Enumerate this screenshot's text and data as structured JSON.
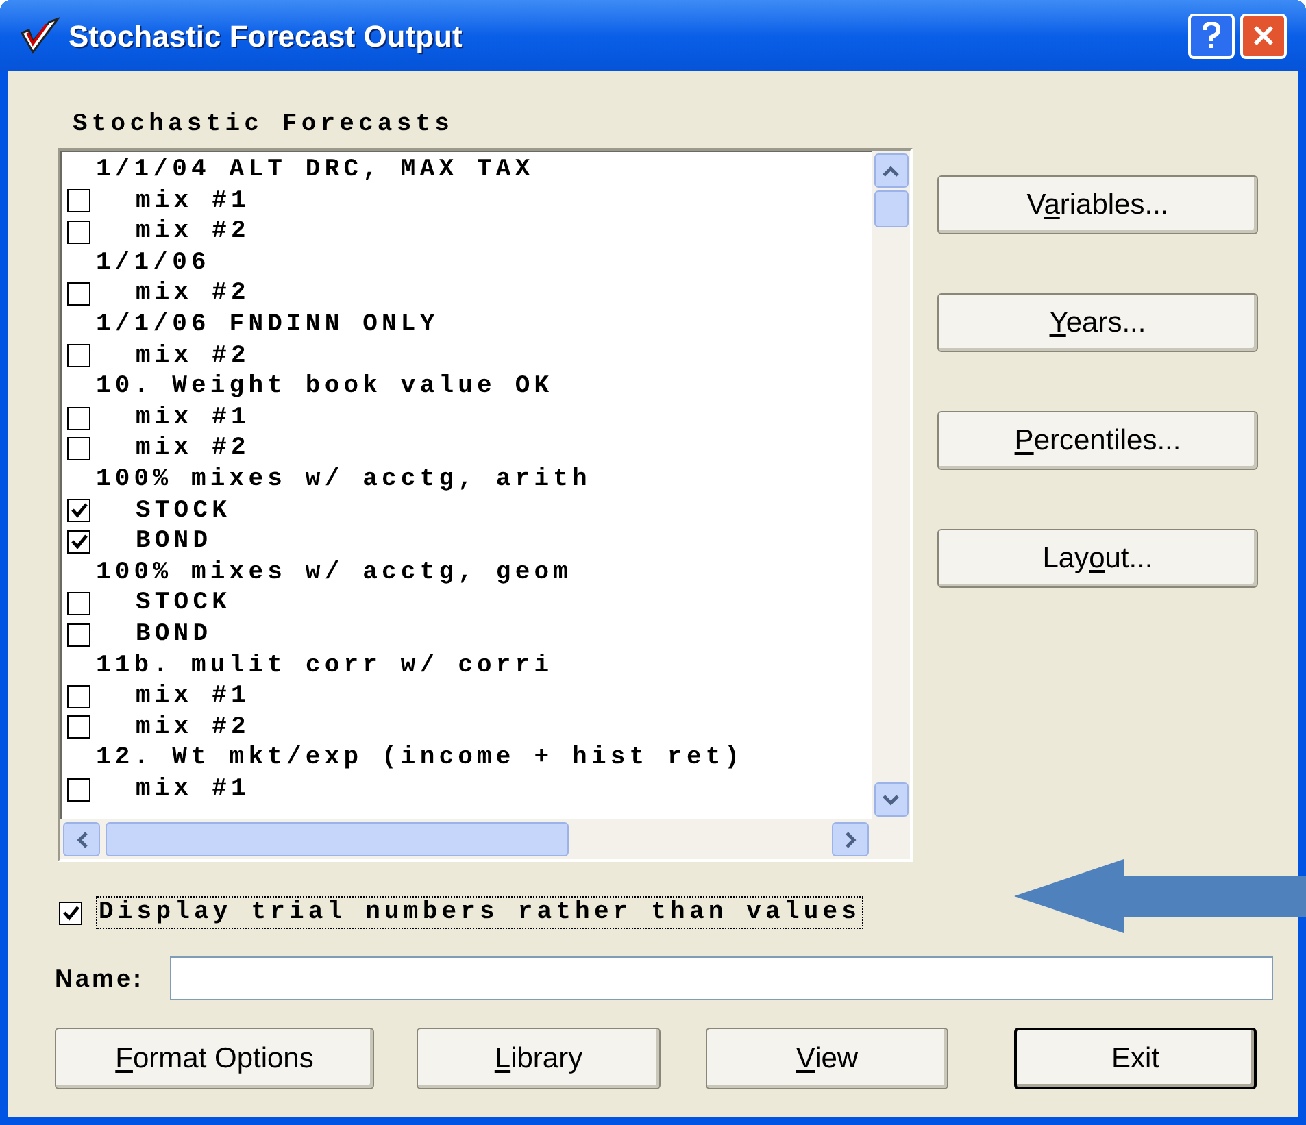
{
  "window": {
    "title": "Stochastic Forecast Output"
  },
  "list_title": "Stochastic Forecasts",
  "forecasts": [
    {
      "title": "1/1/04 ALT DRC, MAX TAX",
      "children": [
        {
          "label": "mix #1",
          "checked": false
        },
        {
          "label": "mix #2",
          "checked": false
        }
      ]
    },
    {
      "title": "1/1/06",
      "children": [
        {
          "label": "mix #2",
          "checked": false
        }
      ]
    },
    {
      "title": "1/1/06 FNDINN ONLY",
      "children": [
        {
          "label": "mix #2",
          "checked": false
        }
      ]
    },
    {
      "title": "10. Weight book value OK",
      "children": [
        {
          "label": "mix #1",
          "checked": false
        },
        {
          "label": "mix #2",
          "checked": false
        }
      ]
    },
    {
      "title": "100% mixes w/ acctg, arith",
      "children": [
        {
          "label": "STOCK",
          "checked": true
        },
        {
          "label": "BOND",
          "checked": true
        }
      ]
    },
    {
      "title": "100% mixes w/ acctg, geom",
      "children": [
        {
          "label": "STOCK",
          "checked": false
        },
        {
          "label": "BOND",
          "checked": false
        }
      ]
    },
    {
      "title": "11b. mulit corr w/ corri",
      "children": [
        {
          "label": "mix #1",
          "checked": false
        },
        {
          "label": "mix #2",
          "checked": false
        }
      ]
    },
    {
      "title": "12. Wt mkt/exp (income + hist ret)",
      "children": [
        {
          "label": "mix #1",
          "checked": false
        }
      ]
    }
  ],
  "side_buttons": [
    {
      "before": "V",
      "key": "a",
      "after": "riables...",
      "default": false
    },
    {
      "key": "Y",
      "after": "ears...",
      "default": false
    },
    {
      "key": "P",
      "after": "ercentiles...",
      "default": false
    },
    {
      "before": "Lay",
      "key": "o",
      "after": "ut...",
      "default": false
    }
  ],
  "display_trial_numbers": {
    "label": "Display trial numbers rather than values",
    "checked": true
  },
  "name_field": {
    "label": "Name:"
  },
  "bottom_buttons": [
    {
      "key": "F",
      "after": "ormat Options",
      "default": false
    },
    {
      "key": "L",
      "after": "ibrary",
      "default": false
    },
    {
      "key": "V",
      "after": "iew",
      "default": false
    },
    {
      "before": "Exit",
      "default": true
    }
  ]
}
